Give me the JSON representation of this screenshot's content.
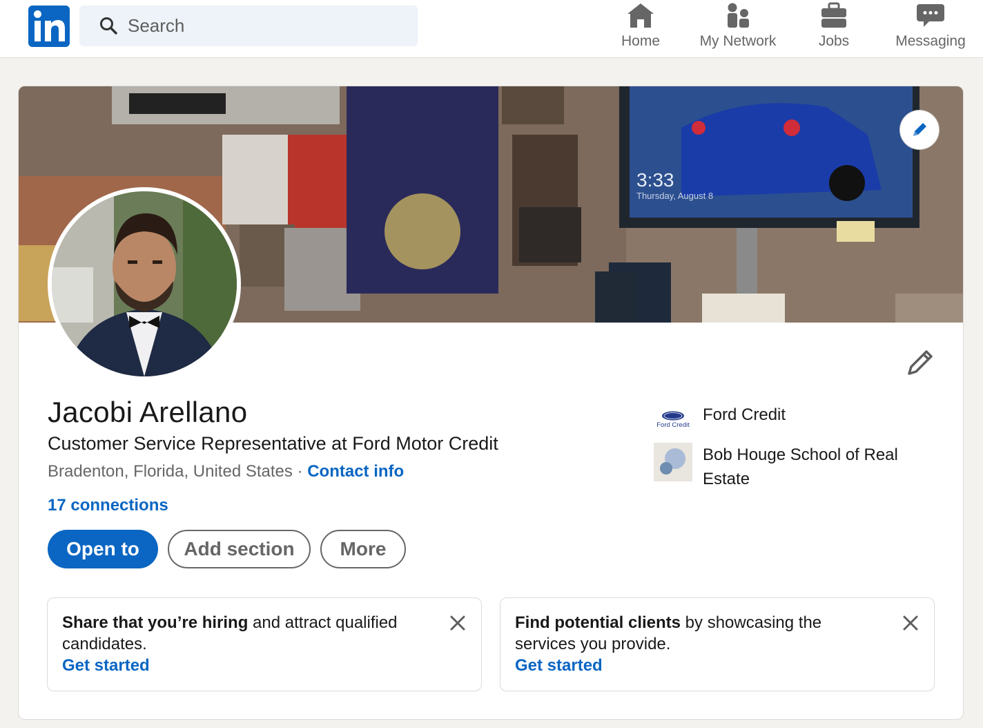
{
  "header": {
    "search_placeholder": "Search",
    "nav": [
      {
        "label": "Home",
        "icon": "home-icon"
      },
      {
        "label": "My Network",
        "icon": "people-icon"
      },
      {
        "label": "Jobs",
        "icon": "briefcase-icon"
      },
      {
        "label": "Messaging",
        "icon": "chat-icon"
      }
    ]
  },
  "banner": {
    "clock_time": "3:33",
    "clock_date": "Thursday, August 8"
  },
  "profile": {
    "name": "Jacobi Arellano",
    "headline": "Customer Service Representative at Ford Motor Credit",
    "location": "Bradenton, Florida, United States",
    "separator": " · ",
    "contact_info": "Contact info",
    "connections": "17 connections"
  },
  "actions": {
    "open_to": "Open to",
    "add_section": "Add section",
    "more": "More"
  },
  "experience": [
    {
      "name": "Ford Credit",
      "logo_text": "Ford Credit"
    },
    {
      "name": "Bob Houge School of Real Estate"
    }
  ],
  "promos": [
    {
      "bold": "Share that you’re hiring",
      "rest": " and attract qualified candidates.",
      "cta": "Get started"
    },
    {
      "bold": "Find potential clients",
      "rest": " by showcasing the services you provide.",
      "cta": "Get started"
    }
  ],
  "colors": {
    "brand": "#0a66c2",
    "page_bg": "#f4f2ee",
    "muted_text": "#666666"
  }
}
